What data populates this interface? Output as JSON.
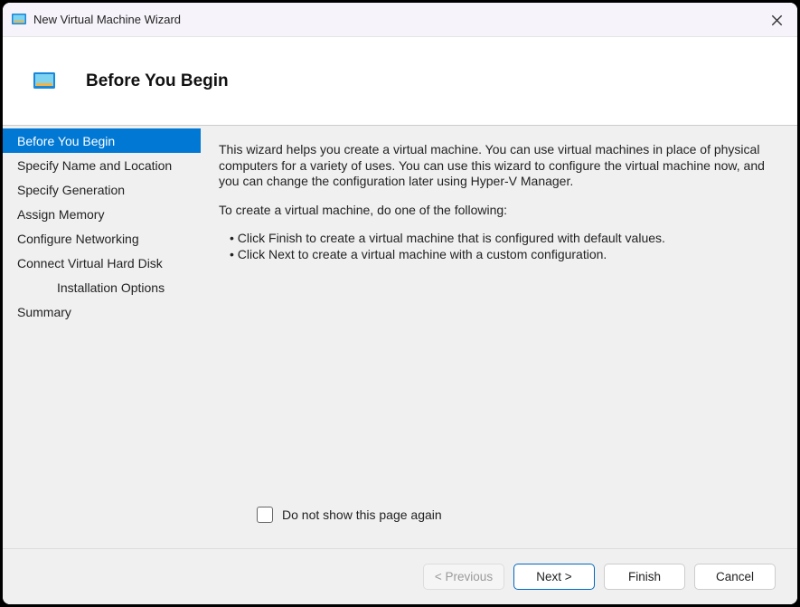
{
  "titlebar": {
    "title": "New Virtual Machine Wizard"
  },
  "header": {
    "title": "Before You Begin"
  },
  "sidebar": {
    "items": [
      {
        "label": "Before You Begin",
        "active": true,
        "indent": false
      },
      {
        "label": "Specify Name and Location",
        "active": false,
        "indent": false
      },
      {
        "label": "Specify Generation",
        "active": false,
        "indent": false
      },
      {
        "label": "Assign Memory",
        "active": false,
        "indent": false
      },
      {
        "label": "Configure Networking",
        "active": false,
        "indent": false
      },
      {
        "label": "Connect Virtual Hard Disk",
        "active": false,
        "indent": false
      },
      {
        "label": "Installation Options",
        "active": false,
        "indent": true
      },
      {
        "label": "Summary",
        "active": false,
        "indent": false
      }
    ]
  },
  "content": {
    "paragraph1": "This wizard helps you create a virtual machine. You can use virtual machines in place of physical computers for a variety of uses. You can use this wizard to configure the virtual machine now, and you can change the configuration later using Hyper-V Manager.",
    "paragraph2": "To create a virtual machine, do one of the following:",
    "bullet1": "Click Finish to create a virtual machine that is configured with default values.",
    "bullet2": "Click Next to create a virtual machine with a custom configuration.",
    "checkbox_label": "Do not show this page again"
  },
  "footer": {
    "previous": "< Previous",
    "next": "Next >",
    "finish": "Finish",
    "cancel": "Cancel"
  }
}
